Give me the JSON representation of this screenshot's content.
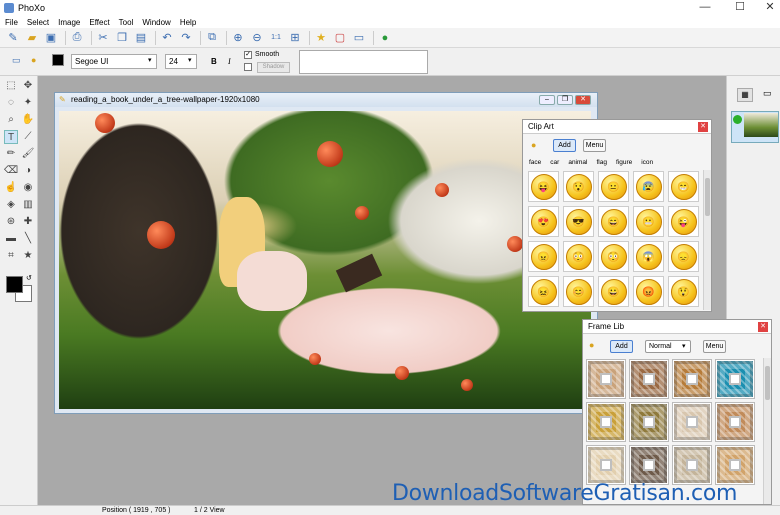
{
  "window": {
    "title": "PhoXo",
    "min": "—",
    "max": "☐",
    "close": "✕"
  },
  "menu": [
    "File",
    "Select",
    "Image",
    "Effect",
    "Tool",
    "Window",
    "Help"
  ],
  "toolbar_icons": [
    "new-icon",
    "open-icon",
    "save-icon",
    "print-icon",
    "cut-icon",
    "copy-icon",
    "paste-icon",
    "undo-icon",
    "redo-icon",
    "scan-icon",
    "zoom-in-icon",
    "zoom-out-icon",
    "actual-size-icon",
    "fit-icon",
    "favorite-icon",
    "frame-icon",
    "window-icon",
    "help-icon"
  ],
  "format": {
    "color": "#000000",
    "font": "Segoe UI",
    "size": "24",
    "bold": "B",
    "italic": "I",
    "smooth": "Smooth",
    "shadow": "Shadow"
  },
  "image_window": {
    "title": "reading_a_book_under_a_tree-wallpaper-1920x1080"
  },
  "clip_art": {
    "title": "Clip Art",
    "add": "Add",
    "menu": "Menu",
    "tabs": [
      "face",
      "car",
      "animal",
      "flag",
      "figure",
      "icon"
    ],
    "faces": [
      "😝",
      "😯",
      "😐",
      "😰",
      "😁",
      "😍",
      "😎",
      "😄",
      "😬",
      "😜",
      "😠",
      "😳",
      "😳",
      "😱",
      "😞",
      "😖",
      "😊",
      "😀",
      "😡",
      "😲"
    ]
  },
  "frame_lib": {
    "title": "Frame Lib",
    "add": "Add",
    "mode": "Normal",
    "menu": "Menu",
    "frames": [
      "#c9a27a",
      "#9a6a44",
      "#b67c3a",
      "#1b8fb0",
      "#c9a03a",
      "#8f7a3c",
      "#d8c6ae",
      "#c18b5a",
      "#e2cfae",
      "#6e5a4a",
      "#c4b49a",
      "#d1a36a"
    ]
  },
  "status": {
    "position": "Position ( 1919 , 705 )",
    "view": "1 / 2 View"
  },
  "watermark": "DownloadSoftwareGratisan.com"
}
